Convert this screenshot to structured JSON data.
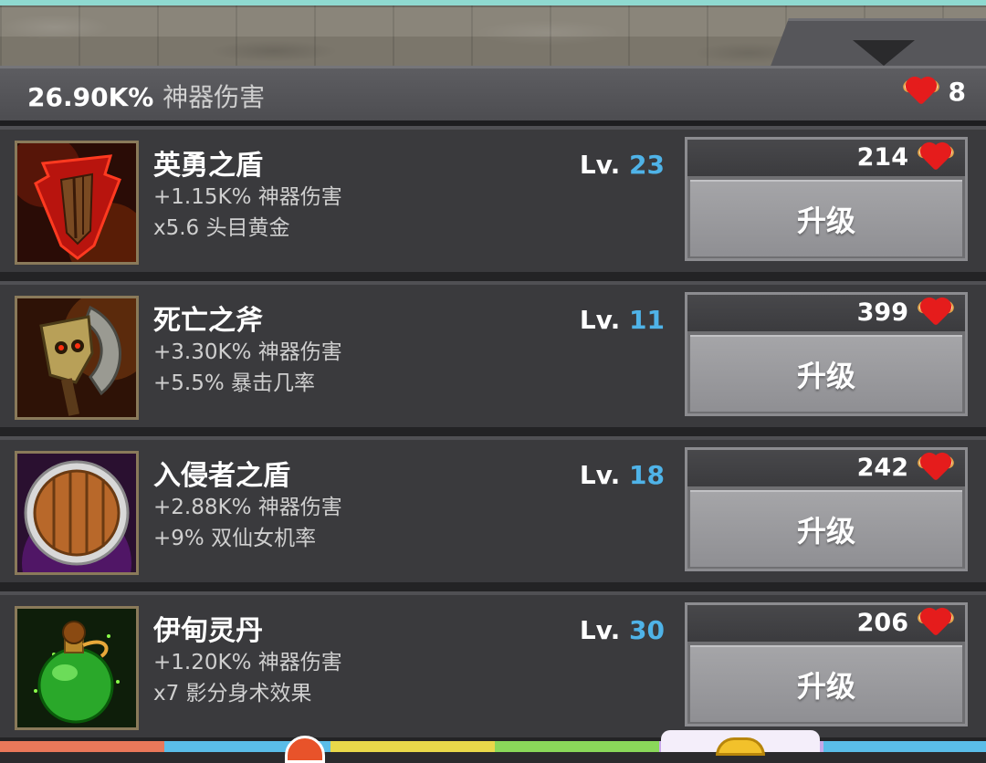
{
  "header": {
    "total_damage": "26.90K%",
    "total_label": "神器伤害",
    "relic_count": "8"
  },
  "artifacts": [
    {
      "name": "英勇之盾",
      "stat1": "+1.15K% 神器伤害",
      "stat2": "x5.6 头目黄金",
      "level_prefix": "Lv.",
      "level": "23",
      "cost": "214",
      "button": "升级",
      "icon": "shield-of-valor-icon"
    },
    {
      "name": "死亡之斧",
      "stat1": "+3.30K% 神器伤害",
      "stat2": "+5.5% 暴击几率",
      "level_prefix": "Lv.",
      "level": "11",
      "cost": "399",
      "button": "升级",
      "icon": "death-axe-icon"
    },
    {
      "name": "入侵者之盾",
      "stat1": "+2.88K% 神器伤害",
      "stat2": "+9% 双仙女机率",
      "level_prefix": "Lv.",
      "level": "18",
      "cost": "242",
      "button": "升级",
      "icon": "invader-shield-icon"
    },
    {
      "name": "伊甸灵丹",
      "stat1": "+1.20K% 神器伤害",
      "stat2": "x7 影分身术效果",
      "level_prefix": "Lv.",
      "level": "30",
      "cost": "206",
      "button": "升级",
      "icon": "elixir-potion-icon"
    }
  ],
  "colors": {
    "level_accent": "#4fb3e8",
    "panel": "#3a3a3d",
    "button": "#9a9a9e"
  }
}
